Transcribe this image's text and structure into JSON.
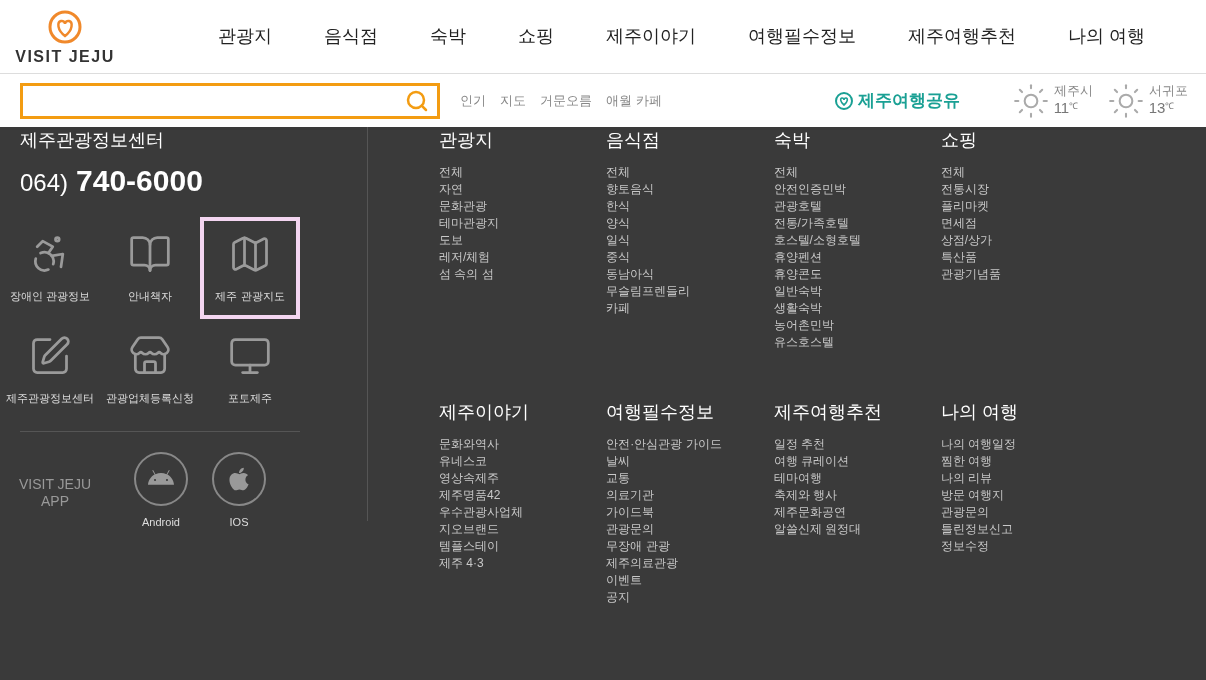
{
  "logo": {
    "text": "VISIT JEJU"
  },
  "nav": [
    "관광지",
    "음식점",
    "숙박",
    "쇼핑",
    "제주이야기",
    "여행필수정보",
    "제주여행추천",
    "나의 여행"
  ],
  "popular_keywords": [
    "인기",
    "지도",
    "거문오름",
    "애월 카페"
  ],
  "share_banner": {
    "text": "제주여행공유"
  },
  "weather": [
    {
      "city": "제주시",
      "temp": "11",
      "unit": "℃"
    },
    {
      "city": "서귀포",
      "temp": "13",
      "unit": "℃"
    }
  ],
  "info_center": {
    "title": "제주관광정보센터",
    "area_code": "064)",
    "phone": "740-6000"
  },
  "quick_links": [
    {
      "kind": "wheelchair",
      "label": "장애인 관광정보",
      "selected": false
    },
    {
      "kind": "book",
      "label": "안내책자",
      "selected": false
    },
    {
      "kind": "map",
      "label": "제주 관광지도",
      "selected": true
    },
    {
      "kind": "edit",
      "label": "제주관광정보센터",
      "selected": false
    },
    {
      "kind": "store",
      "label": "관광업체등록신청",
      "selected": false
    },
    {
      "kind": "monitor",
      "label": "포토제주",
      "selected": false
    }
  ],
  "app": {
    "label_line1": "VISIT JEJU",
    "label_line2": "APP",
    "stores": [
      {
        "kind": "android",
        "label": "Android"
      },
      {
        "kind": "ios",
        "label": "IOS"
      }
    ]
  },
  "menu": [
    {
      "title": "관광지",
      "items": [
        "전체",
        "자연",
        "문화관광",
        "테마관광지",
        "도보",
        "레저/체험",
        "섬 속의 섬"
      ]
    },
    {
      "title": "음식점",
      "items": [
        "전체",
        "향토음식",
        "한식",
        "양식",
        "일식",
        "중식",
        "동남아식",
        "무슬림프렌들리",
        "카페"
      ]
    },
    {
      "title": "숙박",
      "items": [
        "전체",
        "안전인증민박",
        "관광호텔",
        "전통/가족호텔",
        "호스텔/소형호텔",
        "휴양펜션",
        "휴양콘도",
        "일반숙박",
        "생활숙박",
        "농어촌민박",
        "유스호스텔"
      ]
    },
    {
      "title": "쇼핑",
      "items": [
        "전체",
        "전통시장",
        "플리마켓",
        "면세점",
        "상점/상가",
        "특산품",
        "관광기념품"
      ]
    },
    {
      "title": "제주이야기",
      "items": [
        "문화와역사",
        "유네스코",
        "영상속제주",
        "제주명품42",
        "우수관광사업체",
        "지오브랜드",
        "템플스테이",
        "제주 4·3"
      ]
    },
    {
      "title": "여행필수정보",
      "items": [
        "안전·안심관광 가이드",
        "날씨",
        "교통",
        "의료기관",
        "가이드북",
        "관광문의",
        "무장애 관광",
        "제주의료관광",
        "이벤트",
        "공지"
      ]
    },
    {
      "title": "제주여행추천",
      "items": [
        "일정 추천",
        "여행 큐레이션",
        "테마여행",
        "축제와 행사",
        "제주문화공연",
        "알쓸신제 원정대"
      ]
    },
    {
      "title": "나의 여행",
      "items": [
        "나의 여행일정",
        "찜한 여행",
        "나의 리뷰",
        "방문 여행지",
        "관광문의",
        "틀린정보신고",
        "정보수정"
      ]
    }
  ]
}
